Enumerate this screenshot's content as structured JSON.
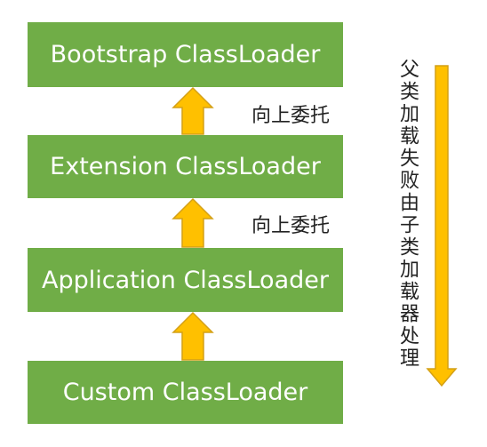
{
  "colors": {
    "box": "#70ad47",
    "arrow_fill": "#ffc000",
    "arrow_stroke": "#d4a017"
  },
  "boxes": {
    "bootstrap": "Bootstrap ClassLoader",
    "extension": "Extension ClassLoader",
    "application": "Application ClassLoader",
    "custom": "Custom ClassLoader"
  },
  "labels": {
    "delegate_up_1": "向上委托",
    "delegate_up_2": "向上委托"
  },
  "side_note": "父类加载失败由子类加载器处理"
}
